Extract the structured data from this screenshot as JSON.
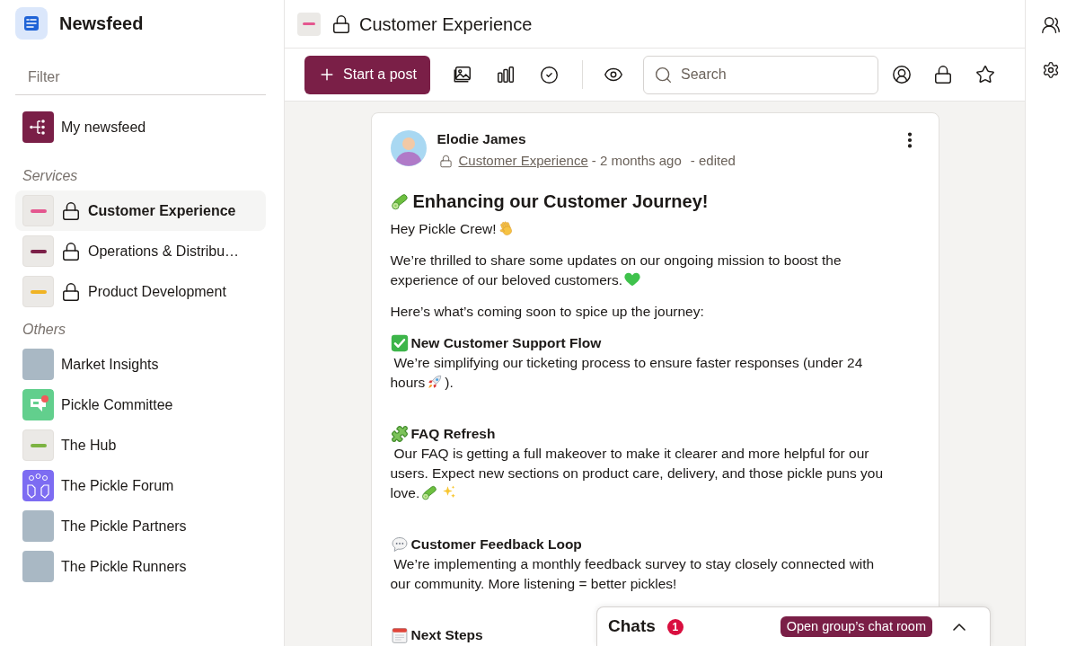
{
  "sidebar": {
    "title": "Newsfeed",
    "filter": {
      "placeholder": "Filter"
    },
    "home": {
      "label": "My newsfeed",
      "selected": false
    },
    "groups": [
      {
        "heading": "Services",
        "items": [
          {
            "label": "Customer Experience",
            "kind": "logo",
            "color": "#e4578f",
            "locked": true,
            "selected": true
          },
          {
            "label": "Operations & Distribu…",
            "kind": "logo",
            "color": "#7b2048",
            "locked": true,
            "selected": false
          },
          {
            "label": "Product Development",
            "kind": "logo",
            "color": "#f0b323",
            "locked": true,
            "selected": false
          }
        ]
      },
      {
        "heading": "Others",
        "items": [
          {
            "label": "Market Insights",
            "kind": "photo",
            "locked": false,
            "selected": false
          },
          {
            "label": "Pickle Committee",
            "kind": "chat",
            "locked": false,
            "selected": false
          },
          {
            "label": "The Hub",
            "kind": "logo",
            "color": "#7cb342",
            "locked": false,
            "selected": false
          },
          {
            "label": "The Pickle Forum",
            "kind": "forum",
            "locked": false,
            "selected": false
          },
          {
            "label": "The Pickle Partners",
            "kind": "photo",
            "locked": false,
            "selected": false
          },
          {
            "label": "The Pickle Runners",
            "kind": "photo",
            "locked": false,
            "selected": false
          }
        ]
      }
    ]
  },
  "header": {
    "title": "Customer Experience",
    "locked": true
  },
  "toolbar": {
    "post_button": "Start a post",
    "search": {
      "placeholder": "Search"
    }
  },
  "post": {
    "author": "Elodie James",
    "locked": true,
    "group_link": "Customer Experience",
    "time": "- 2 months ago",
    "edited": "- edited",
    "title": "Enhancing our Customer Journey!",
    "greeting": "Hey Pickle Crew!",
    "intro": [
      "We’re thrilled to share some updates on our ongoing mission to boost the",
      "experience of our beloved customers."
    ],
    "lead_in": "Here’s what’s coming soon to spice up the journey:",
    "sections": [
      {
        "heading": "New Customer Support Flow",
        "lines": [
          [
            "We’re simplifying our ticketing process to ensure faster responses (under 24"
          ],
          [
            "hours",
            ")."
          ]
        ]
      },
      {
        "heading": "FAQ Refresh",
        "lines": [
          [
            "Our FAQ is getting a full makeover to make it clearer and more helpful for our users. Expect new sections on product care, delivery, and those pickle puns you"
          ],
          [
            "love."
          ]
        ]
      },
      {
        "heading": "Customer Feedback Loop",
        "lines": [
          [
            "We’re implementing a monthly feedback survey to stay closely connected with our community. More listening = better pickles!"
          ]
        ]
      },
      {
        "heading": "Next Steps"
      }
    ]
  },
  "chats": {
    "title": "Chats",
    "count": "1",
    "open_button": "Open group’s chat room"
  }
}
